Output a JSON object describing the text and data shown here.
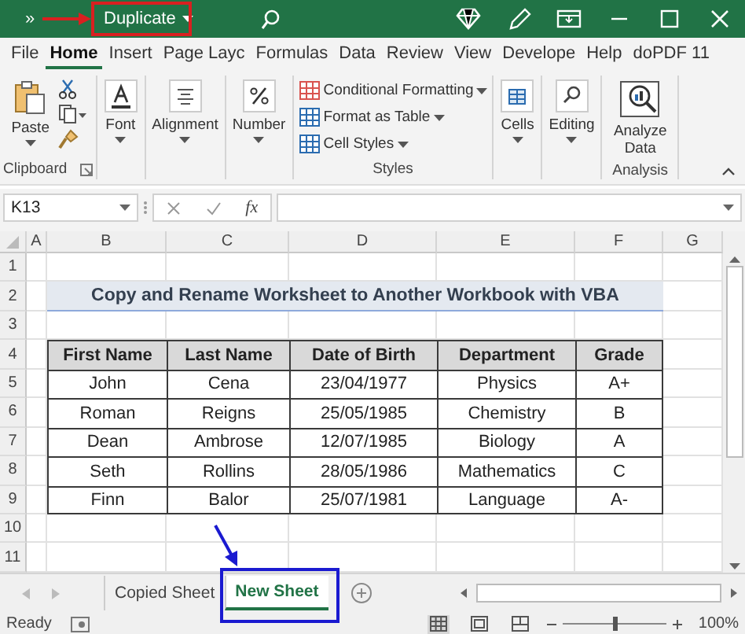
{
  "title_bar": {
    "overflow": "»",
    "quick_command": {
      "label": "Duplicate",
      "dropdown": true
    }
  },
  "ribbon_tabs": [
    {
      "label": "File",
      "selected": false
    },
    {
      "label": "Home",
      "selected": true
    },
    {
      "label": "Insert",
      "selected": false
    },
    {
      "label": "Page Layc",
      "selected": false
    },
    {
      "label": "Formulas",
      "selected": false
    },
    {
      "label": "Data",
      "selected": false
    },
    {
      "label": "Review",
      "selected": false
    },
    {
      "label": "View",
      "selected": false
    },
    {
      "label": "Develope",
      "selected": false
    },
    {
      "label": "Help",
      "selected": false
    },
    {
      "label": "doPDF 11",
      "selected": false
    }
  ],
  "ribbon_groups": [
    {
      "kind": "clipboard",
      "label": "Clipboard",
      "launcher": true,
      "commands": [
        {
          "kind": "large",
          "label": "Paste",
          "dropdown": true
        },
        {
          "kind": "tools"
        }
      ]
    },
    {
      "kind": "font",
      "commands": [
        {
          "kind": "large",
          "label": "Font",
          "dropdown": true
        }
      ]
    },
    {
      "kind": "alignment",
      "commands": [
        {
          "kind": "large",
          "label": "Alignment",
          "dropdown": true
        }
      ]
    },
    {
      "kind": "number",
      "commands": [
        {
          "kind": "large",
          "label": "Number",
          "dropdown": true
        }
      ]
    },
    {
      "kind": "styles",
      "label": "Styles",
      "commands": [
        {
          "kind": "small",
          "label": "Conditional Formatting",
          "dropdown": true
        },
        {
          "kind": "small",
          "label": "Format as Table",
          "dropdown": true
        },
        {
          "kind": "small",
          "label": "Cell Styles",
          "dropdown": true
        }
      ]
    },
    {
      "kind": "cells",
      "commands": [
        {
          "kind": "large",
          "label": "Cells",
          "dropdown": true
        }
      ]
    },
    {
      "kind": "editing",
      "commands": [
        {
          "kind": "large",
          "label": "Editing",
          "dropdown": true
        }
      ]
    },
    {
      "kind": "analysis",
      "label": "Analysis",
      "commands": [
        {
          "kind": "large",
          "label": "Analyze Data",
          "dropdown": false
        }
      ]
    }
  ],
  "formula_bar": {
    "name_box": "K13",
    "function_button": "fx"
  },
  "sheet": {
    "columns": [
      "A",
      "B",
      "C",
      "D",
      "E",
      "F",
      "G"
    ],
    "rows": [
      {
        "number": "1",
        "kind": "blank"
      },
      {
        "number": "2",
        "kind": "title",
        "text": "Copy and Rename Worksheet to Another Workbook with VBA"
      },
      {
        "number": "3",
        "kind": "blank"
      },
      {
        "number": "4",
        "kind": "header",
        "cells": [
          "First Name",
          "Last Name",
          "Date of Birth",
          "Department",
          "Grade"
        ]
      },
      {
        "number": "5",
        "kind": "data",
        "cells": [
          "John",
          "Cena",
          "23/04/1977",
          "Physics",
          "A+"
        ]
      },
      {
        "number": "6",
        "kind": "data",
        "cells": [
          "Roman",
          "Reigns",
          "25/05/1985",
          "Chemistry",
          "B"
        ]
      },
      {
        "number": "7",
        "kind": "data",
        "cells": [
          "Dean",
          "Ambrose",
          "12/07/1985",
          "Biology",
          "A"
        ]
      },
      {
        "number": "8",
        "kind": "data",
        "cells": [
          "Seth",
          "Rollins",
          "28/05/1986",
          "Mathematics",
          "C"
        ]
      },
      {
        "number": "9",
        "kind": "data",
        "cells": [
          "Finn",
          "Balor",
          "25/07/1981",
          "Language",
          "A-"
        ]
      },
      {
        "number": "10",
        "kind": "blank"
      },
      {
        "number": "11",
        "kind": "blank"
      }
    ]
  },
  "sheet_tabs": [
    {
      "label": "Copied Sheet",
      "selected": false
    },
    {
      "label": "New Sheet",
      "selected": true
    }
  ],
  "status_bar": {
    "status": "Ready",
    "views": [
      {
        "kind": "normal",
        "selected": true
      },
      {
        "kind": "page-layout",
        "selected": false
      },
      {
        "kind": "page-break",
        "selected": false
      }
    ],
    "zoom_slider": {
      "level": 0.5
    },
    "zoom": "100%"
  }
}
